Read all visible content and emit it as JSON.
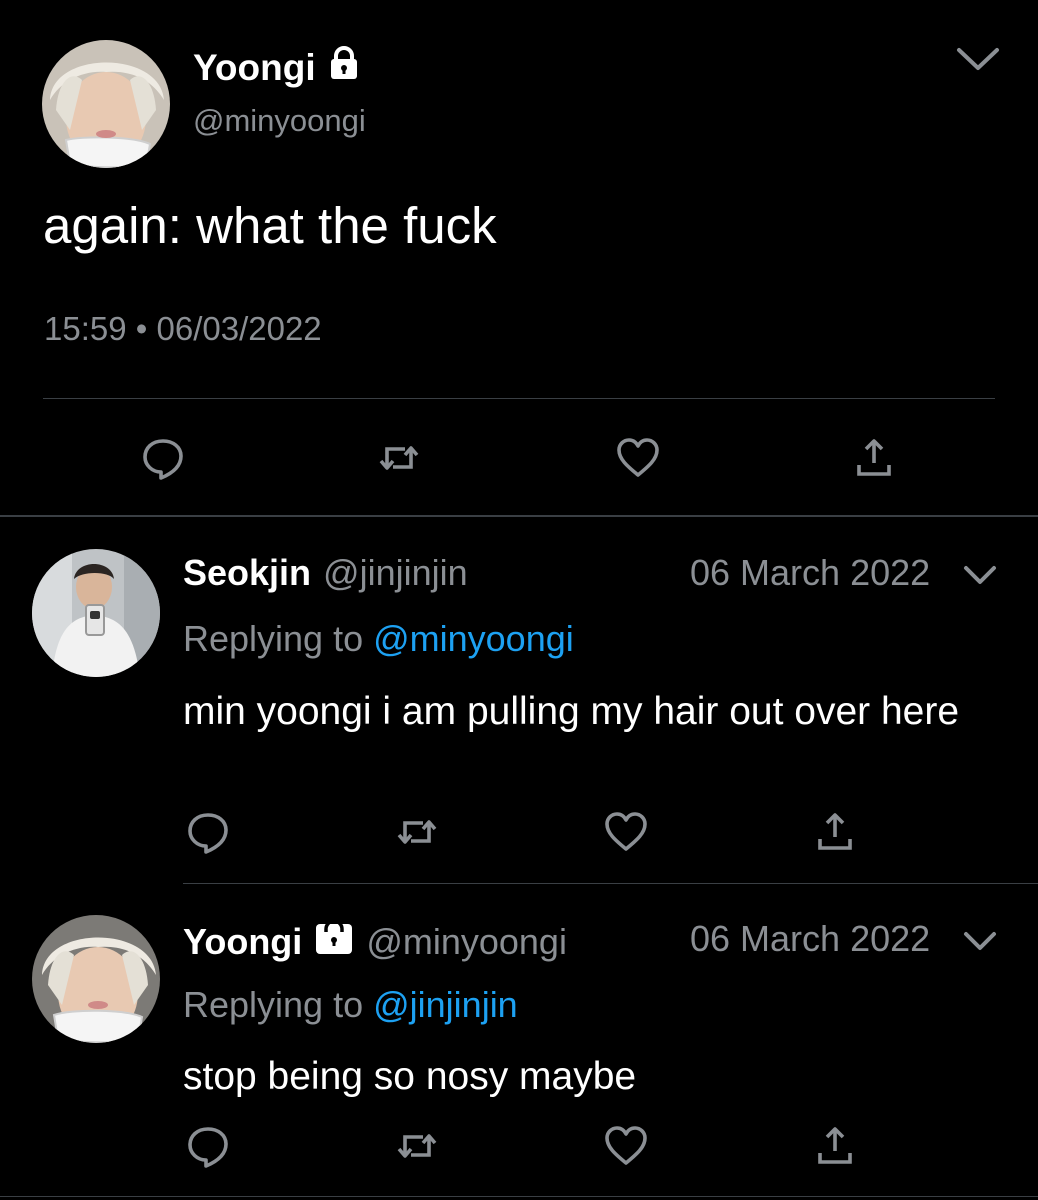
{
  "main_tweet": {
    "name": "Yoongi",
    "handle": "@minyoongi",
    "text": "again: what the fuck",
    "time": "15:59",
    "separator": "•",
    "date": "06/03/2022",
    "avatar_icon": "user-photo-blond-hair-mask",
    "actions": [
      "reply-icon",
      "retweet-icon",
      "like-icon",
      "share-icon"
    ]
  },
  "replies": [
    {
      "name": "Seokjin",
      "handle": "@jinjinjin",
      "date": "06 March 2022",
      "replying_prefix": "Replying to ",
      "replying_to": "@minyoongi",
      "text": "min yoongi i am pulling my hair out over here",
      "locked": false,
      "avatar_icon": "user-photo-mirror-selfie"
    },
    {
      "name": "Yoongi",
      "handle": "@minyoongi",
      "date": "06 March 2022",
      "replying_prefix": "Replying to ",
      "replying_to": "@jinjinjin",
      "text": "stop being so nosy maybe",
      "locked": true,
      "avatar_icon": "user-photo-blond-hair-mask"
    }
  ],
  "colors": {
    "background": "#000000",
    "text_primary": "#ffffff",
    "text_secondary": "#8b8f94",
    "mention": "#1da1f2",
    "divider": "#3a3f44"
  }
}
